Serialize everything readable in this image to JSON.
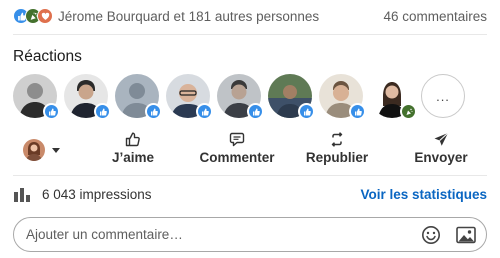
{
  "social_counts": {
    "reactors_text": "Jérome Bourquard et 181 autres personnes",
    "comments_text": "46 commentaires",
    "reaction_types": [
      "like-icon",
      "celebrate-icon",
      "love-icon"
    ]
  },
  "reactions_section": {
    "title": "Réactions",
    "more_label": "..."
  },
  "actions": {
    "like": "J’aime",
    "comment": "Commenter",
    "repost": "Republier",
    "send": "Envoyer"
  },
  "stats": {
    "impressions": "6 043 impressions",
    "link": "Voir les statistiques"
  },
  "comment_box": {
    "placeholder": "Ajouter un commentaire…"
  },
  "colors": {
    "like_blue": "#378fe9",
    "celebrate_green": "#44712e",
    "love_red": "#df704d",
    "link_blue": "#0a66c2"
  }
}
